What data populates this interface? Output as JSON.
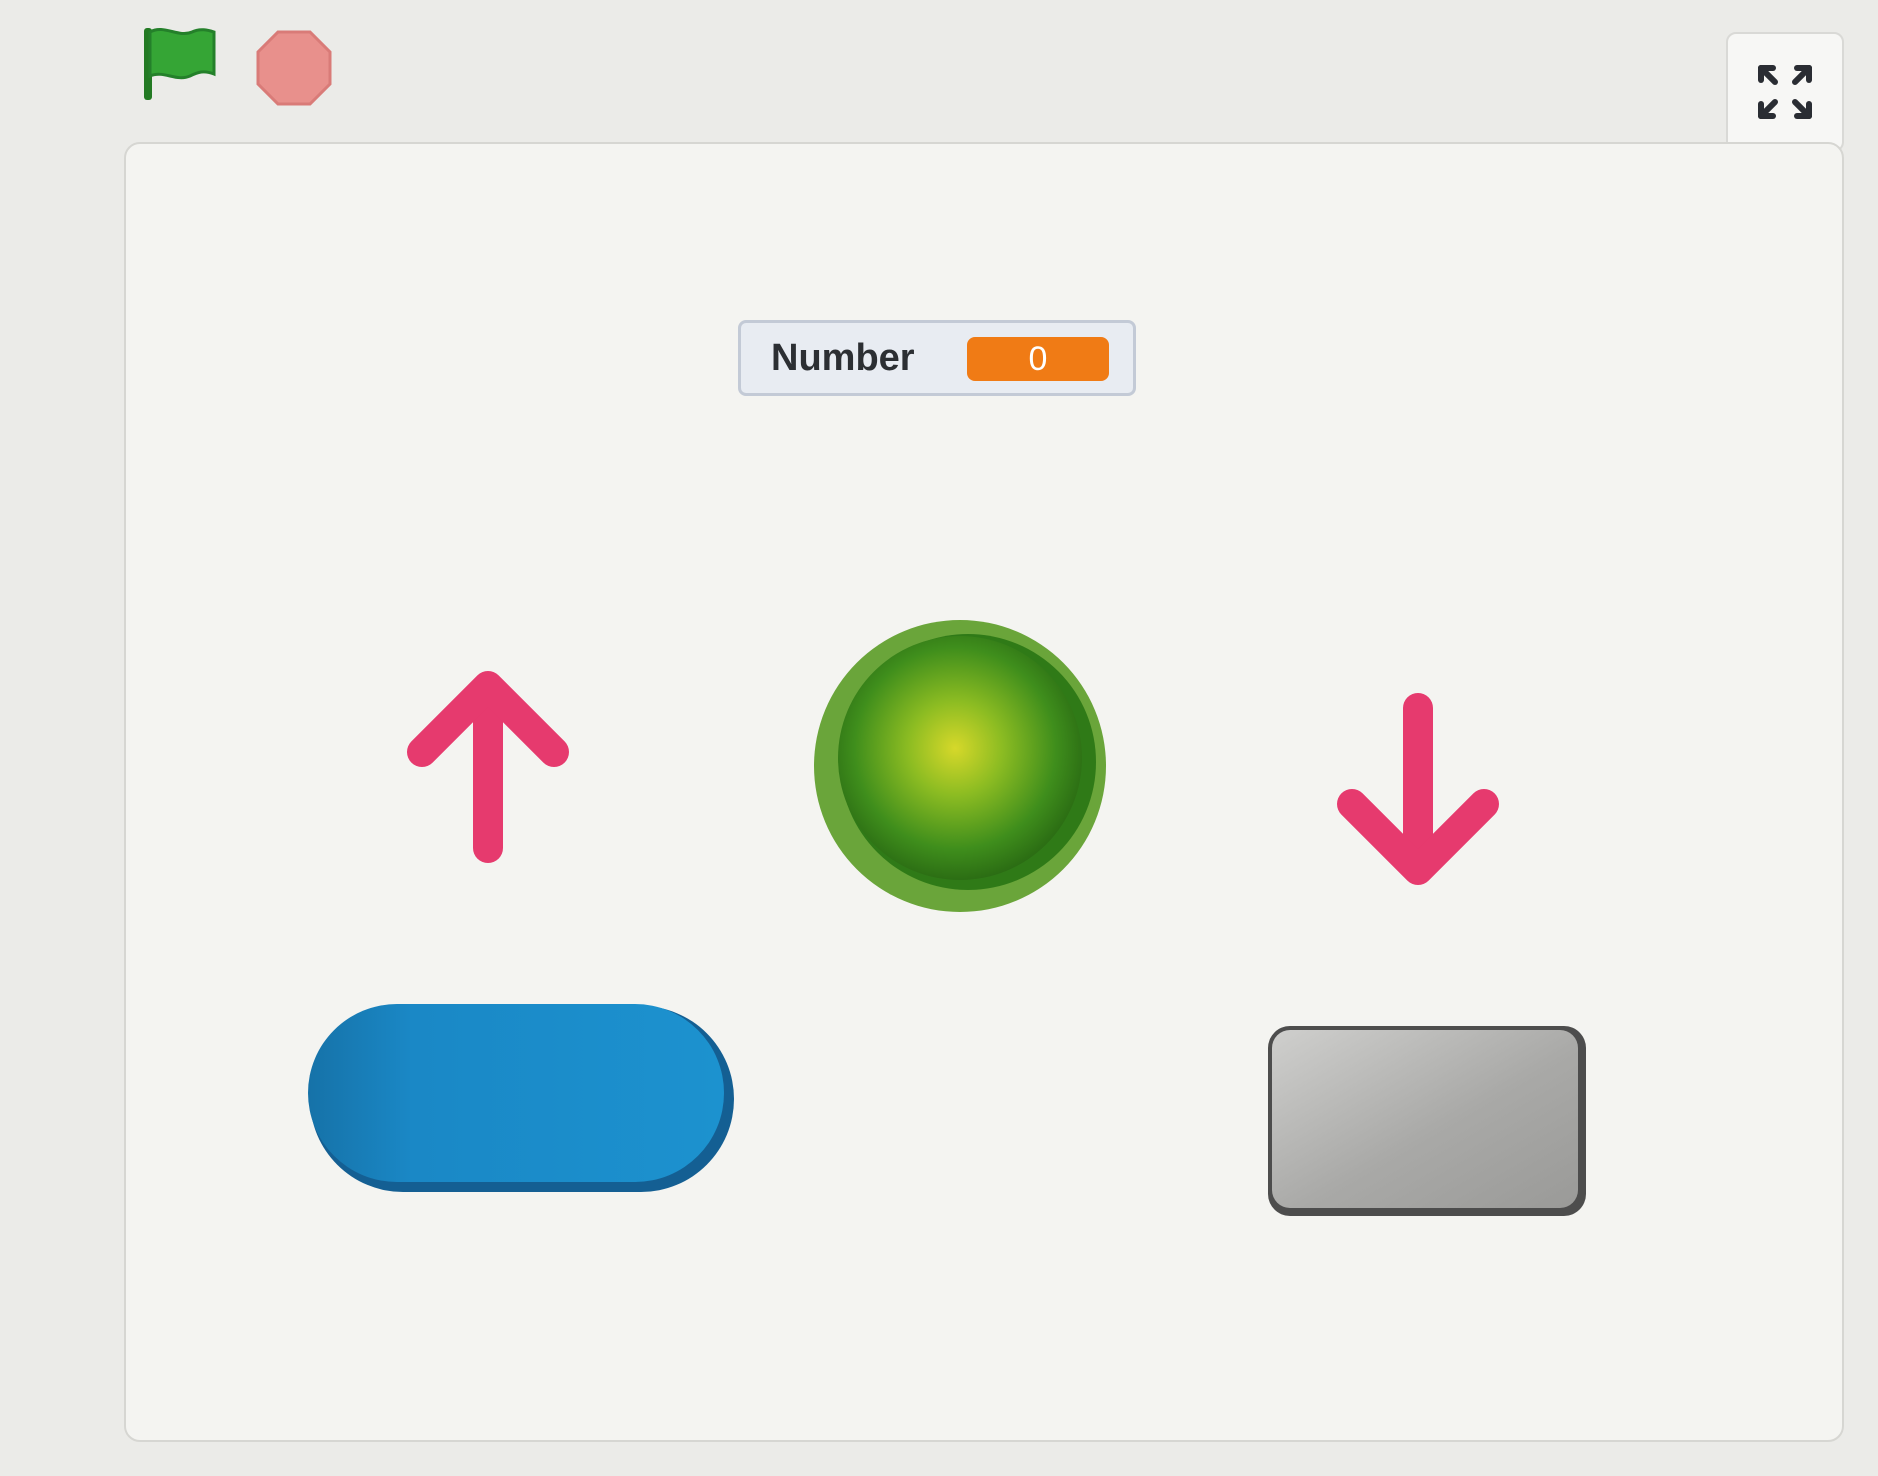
{
  "toolbar": {
    "green_flag_icon": "green-flag-icon",
    "stop_icon": "stop-icon",
    "fullscreen_icon": "fullscreen-icon"
  },
  "stage": {
    "variable_monitor": {
      "label": "Number",
      "value": "0"
    },
    "sprites": [
      {
        "name": "up-arrow",
        "color": "#e63a6e"
      },
      {
        "name": "green-ball",
        "color": "#5aa32a"
      },
      {
        "name": "down-arrow",
        "color": "#e63a6e"
      },
      {
        "name": "blue-button",
        "color": "#1a86c3"
      },
      {
        "name": "gray-button",
        "color": "#a8a8a8"
      }
    ]
  },
  "colors": {
    "flag_green": "#2e9a2e",
    "stop_red": "#e8908c",
    "monitor_orange": "#f07b15",
    "arrow_pink": "#e63a6e",
    "button_blue": "#1a86c3",
    "ball_green": "#5aa32a",
    "button_gray": "#a8a8a8"
  }
}
